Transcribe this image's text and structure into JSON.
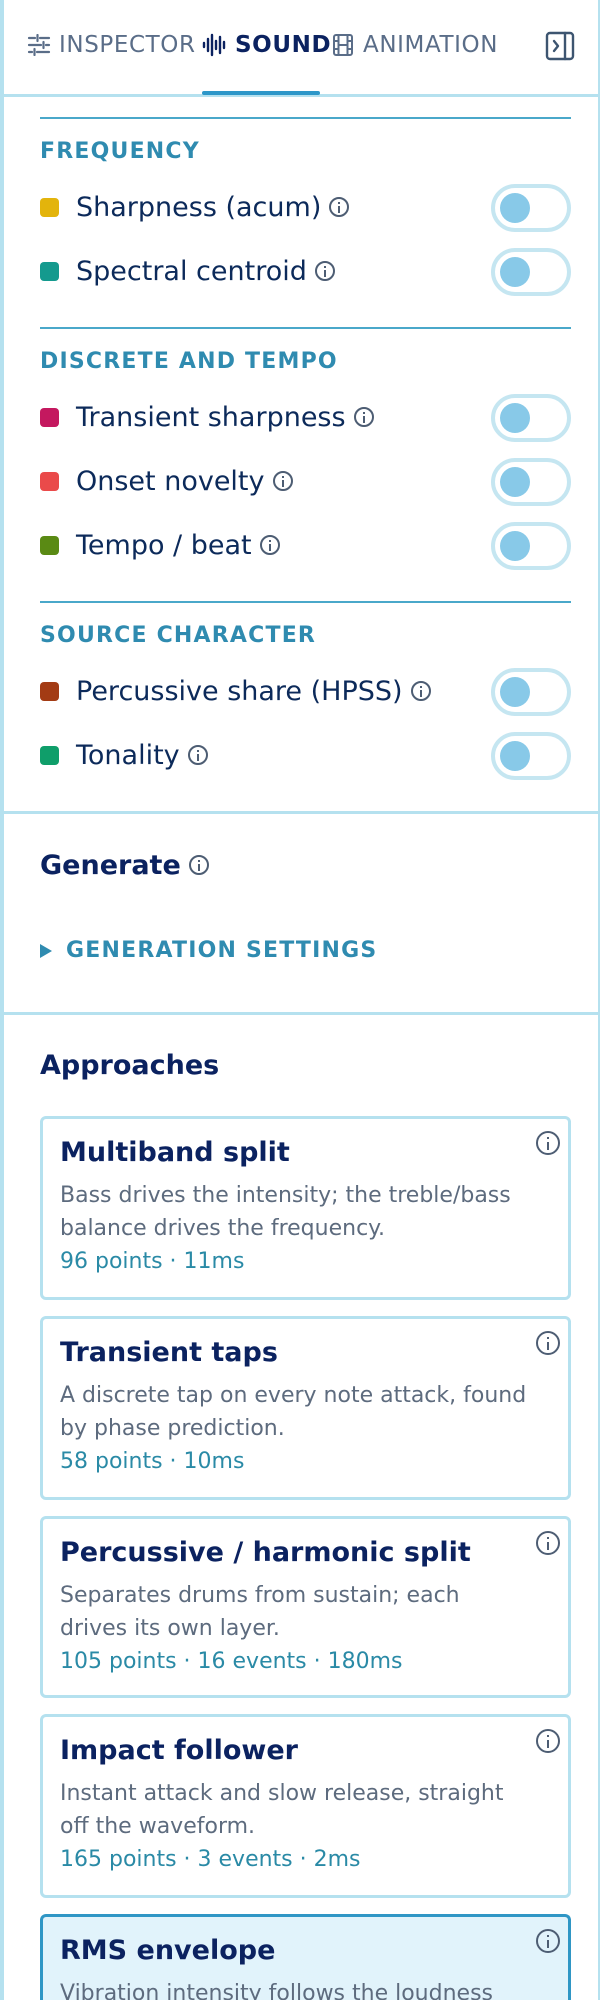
{
  "tabs": [
    {
      "label": "INSPECTOR",
      "icon": "sliders-icon"
    },
    {
      "label": "SOUND",
      "icon": "waveform-icon"
    },
    {
      "label": "ANIMATION",
      "icon": "film-icon"
    }
  ],
  "active_tab": "SOUND",
  "sections": [
    {
      "label": "FREQUENCY",
      "items": [
        {
          "label": "Sharpness (acum)",
          "color": "#e3b40c",
          "on": false
        },
        {
          "label": "Spectral centroid",
          "color": "#149a8e",
          "on": false
        }
      ]
    },
    {
      "label": "DISCRETE AND TEMPO",
      "items": [
        {
          "label": "Transient sharpness",
          "color": "#c4185f",
          "on": false
        },
        {
          "label": "Onset novelty",
          "color": "#ea4a4a",
          "on": false
        },
        {
          "label": "Tempo / beat",
          "color": "#5a8a14",
          "on": false
        }
      ]
    },
    {
      "label": "SOURCE CHARACTER",
      "items": [
        {
          "label": "Percussive share (HPSS)",
          "color": "#a33b14",
          "on": false
        },
        {
          "label": "Tonality",
          "color": "#0f9e6a",
          "on": false
        }
      ]
    }
  ],
  "generate": {
    "title": "Generate",
    "settings_label": "GENERATION SETTINGS"
  },
  "approaches": {
    "title": "Approaches",
    "cards": [
      {
        "title": "Multiband split",
        "desc": "Bass drives the intensity; the treble/bass balance drives the frequency.",
        "meta": "96 points · 11ms",
        "selected": false
      },
      {
        "title": "Transient taps",
        "desc": "A discrete tap on every note attack, found by phase prediction.",
        "meta": "58 points · 10ms",
        "selected": false
      },
      {
        "title": "Percussive / harmonic split",
        "desc": "Separates drums from sustain; each drives its own layer.",
        "meta": "105 points · 16 events · 180ms",
        "selected": false
      },
      {
        "title": "Impact follower",
        "desc": "Instant attack and slow release, straight off the waveform.",
        "meta": "165 points · 3 events · 2ms",
        "selected": false
      },
      {
        "title": "RMS envelope",
        "desc": "Vibration intensity follows the loudness",
        "meta": "",
        "selected": true
      }
    ]
  }
}
